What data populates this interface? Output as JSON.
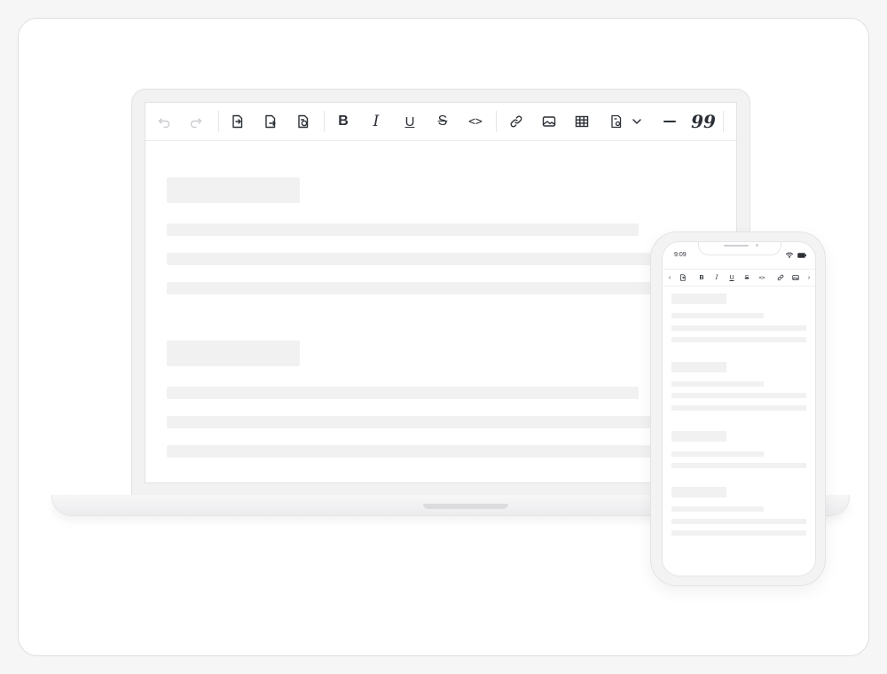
{
  "laptop": {
    "toolbar": [
      {
        "name": "undo-button",
        "label": "↶",
        "icon": "undo-icon",
        "disabled": true
      },
      {
        "name": "redo-button",
        "label": "↷",
        "icon": "redo-icon",
        "disabled": true
      },
      {
        "name": "import-doc-button",
        "icon": "import-document-icon"
      },
      {
        "name": "export-doc-button",
        "icon": "export-document-icon"
      },
      {
        "name": "convert-doc-button",
        "icon": "convert-document-icon"
      },
      {
        "name": "bold-button",
        "label": "B"
      },
      {
        "name": "italic-button",
        "label": "I"
      },
      {
        "name": "underline-button",
        "label": "U"
      },
      {
        "name": "strikethrough-button",
        "label": "S"
      },
      {
        "name": "code-button",
        "label": "<>"
      },
      {
        "name": "link-button",
        "icon": "link-icon"
      },
      {
        "name": "image-button",
        "icon": "image-icon"
      },
      {
        "name": "table-button",
        "icon": "table-icon"
      },
      {
        "name": "template-button",
        "icon": "template-icon"
      },
      {
        "name": "more-dropdown-button",
        "icon": "chevron-down-icon"
      },
      {
        "name": "horizontal-rule-button",
        "label": "—"
      },
      {
        "name": "blockquote-button",
        "label": "99"
      }
    ]
  },
  "phone": {
    "status_time": "9:09",
    "toolbar": [
      {
        "name": "scroll-left-button",
        "label": "‹"
      },
      {
        "name": "import-doc-button",
        "icon": "import-document-icon"
      },
      {
        "name": "bold-button",
        "label": "B"
      },
      {
        "name": "italic-button",
        "label": "I"
      },
      {
        "name": "underline-button",
        "label": "U"
      },
      {
        "name": "strikethrough-button",
        "label": "S"
      },
      {
        "name": "code-button",
        "label": "<>"
      },
      {
        "name": "link-button",
        "icon": "link-icon"
      },
      {
        "name": "image-button",
        "icon": "image-icon"
      },
      {
        "name": "scroll-right-button",
        "label": "›"
      }
    ]
  }
}
